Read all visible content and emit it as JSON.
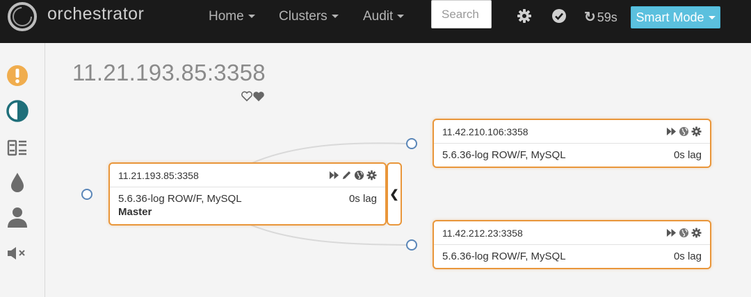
{
  "navbar": {
    "brand": "orchestrator",
    "menu": [
      {
        "label": "Home"
      },
      {
        "label": "Clusters"
      },
      {
        "label": "Audit"
      }
    ],
    "search_placeholder": "Search",
    "refresh_countdown": "59s",
    "mode_button": "Smart Mode"
  },
  "sidebar": {
    "icons": [
      "exclamation-circle-icon",
      "half-circle-icon",
      "tag-list-icon",
      "tint-drop-icon",
      "user-icon",
      "volume-off-icon"
    ],
    "accent_orange": "#f0ad4e",
    "accent_teal": "#1f6f7a"
  },
  "page": {
    "title": "11.21.193.85:3358"
  },
  "topology": {
    "colors": {
      "border": "#e9963a",
      "dot": "#5a86b8",
      "edge": "#d9d9d9"
    },
    "master": {
      "host": "11.21.193.85:3358",
      "version": "5.6.36-log ROW/F, MySQL",
      "lag": "0s lag",
      "role": "Master"
    },
    "replicas": [
      {
        "host": "11.42.210.106:3358",
        "version": "5.6.36-log ROW/F, MySQL",
        "lag": "0s lag"
      },
      {
        "host": "11.42.212.23:3358",
        "version": "5.6.36-log ROW/F, MySQL",
        "lag": "0s lag"
      }
    ]
  }
}
